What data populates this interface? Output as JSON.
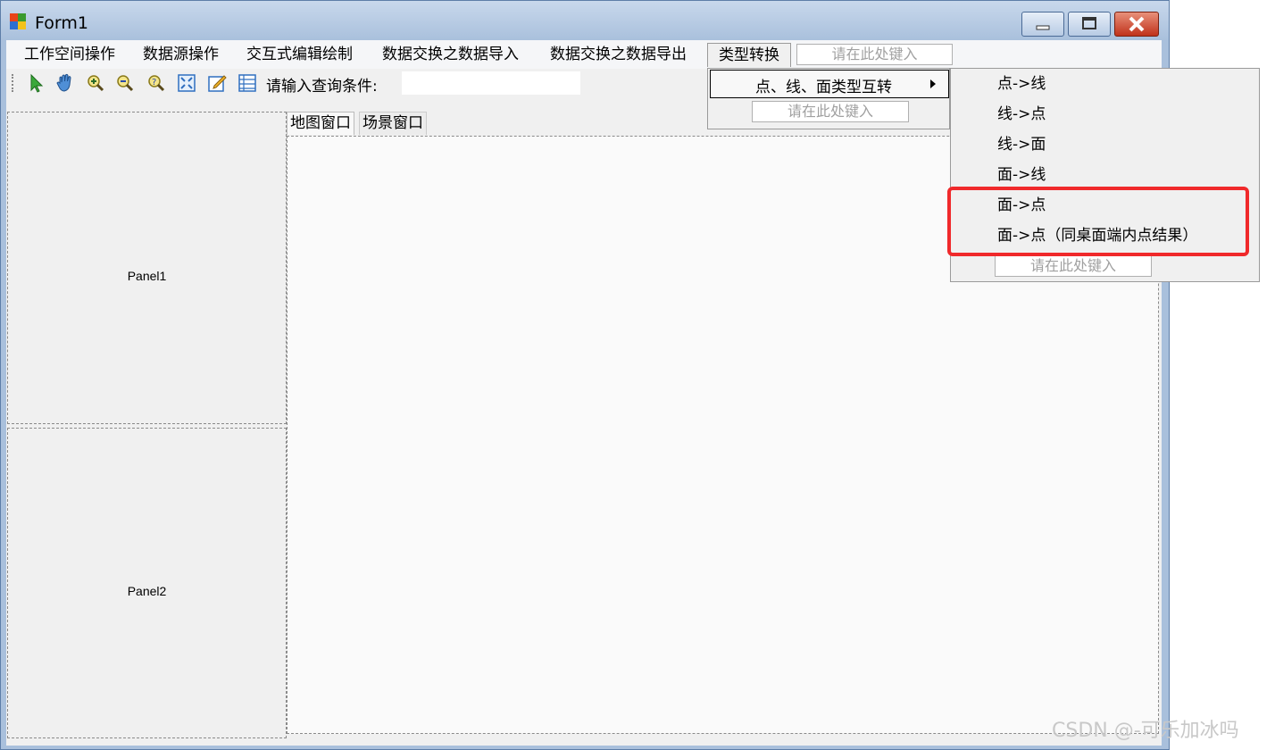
{
  "window": {
    "title": "Form1",
    "minimize": "minimize",
    "maximize": "maximize",
    "close": "close"
  },
  "menu": {
    "items": [
      "工作空间操作",
      "数据源操作",
      "交互式编辑绘制",
      "数据交换之数据导入",
      "数据交换之数据导出",
      "类型转换"
    ],
    "entry_placeholder": "请在此处键入"
  },
  "toolbar": {
    "icons": [
      "select-arrow-icon",
      "pan-hand-icon",
      "zoom-in-icon",
      "zoom-out-icon",
      "identify-icon",
      "full-extent-icon",
      "edit-icon",
      "attribute-table-icon"
    ],
    "query_label": "请输入查询条件:",
    "query_value": ""
  },
  "panels": {
    "panel1": "Panel1",
    "panel2": "Panel2"
  },
  "tabs": [
    "地图窗口",
    "场景窗口"
  ],
  "dropdown_type_convert": {
    "item": "点、线、面类型互转",
    "entry_placeholder": "请在此处键入"
  },
  "submenu": {
    "items": [
      "点->线",
      "线->点",
      "线->面",
      "面->线",
      "面->点",
      "面->点（同桌面端内点结果）"
    ],
    "entry_placeholder": "请在此处键入"
  },
  "watermark": "CSDN @-可乐加冰吗",
  "colors": {
    "highlight": "#f0292b",
    "titlebar": "#a9c0dc"
  }
}
